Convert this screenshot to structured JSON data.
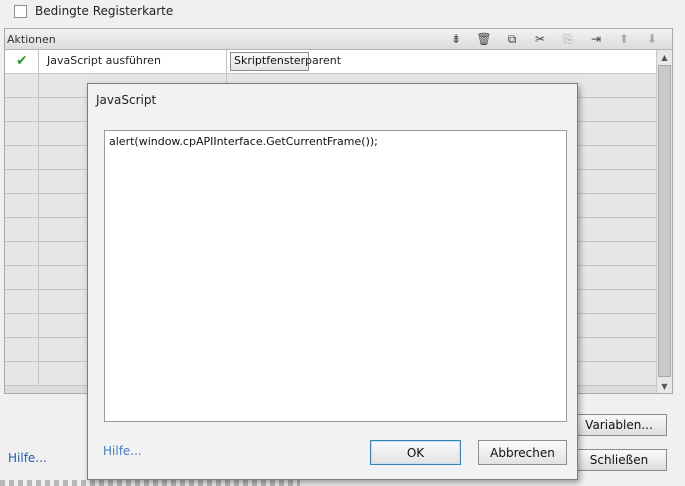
{
  "conditional": {
    "label": "Bedingte Registerkarte",
    "checked": false
  },
  "actions": {
    "title": "Aktionen",
    "toolbar": [
      {
        "icon": "insert-row-icon",
        "glyph": "⇟",
        "enabled": true
      },
      {
        "icon": "trash-icon",
        "glyph": "🗑",
        "enabled": true
      },
      {
        "icon": "copy-icon",
        "glyph": "⧉",
        "enabled": true
      },
      {
        "icon": "cut-icon",
        "glyph": "✂",
        "enabled": true
      },
      {
        "icon": "paste-icon",
        "glyph": "⎘",
        "enabled": false
      },
      {
        "icon": "insert-after-icon",
        "glyph": "⇥",
        "enabled": true
      },
      {
        "icon": "move-up-icon",
        "glyph": "⬆",
        "enabled": false
      },
      {
        "icon": "move-down-icon",
        "glyph": "⬇",
        "enabled": false
      }
    ],
    "rows": [
      {
        "status_icon": "check-icon",
        "action": "JavaScript ausführen",
        "button": "Skriptfenster",
        "target": "parent"
      }
    ],
    "empty_rows": 13
  },
  "footer": {
    "help": "Hilfe...",
    "variables": "Variablen...",
    "close": "Schließen"
  },
  "dialog": {
    "title": "JavaScript",
    "code": "alert(window.cpAPIInterface.GetCurrentFrame());",
    "help": "Hilfe...",
    "ok": "OK",
    "cancel": "Abbrechen"
  },
  "colors": {
    "link": "#1f5fa6",
    "check": "#2e9a2e",
    "ok_border": "#3c7fb1"
  }
}
